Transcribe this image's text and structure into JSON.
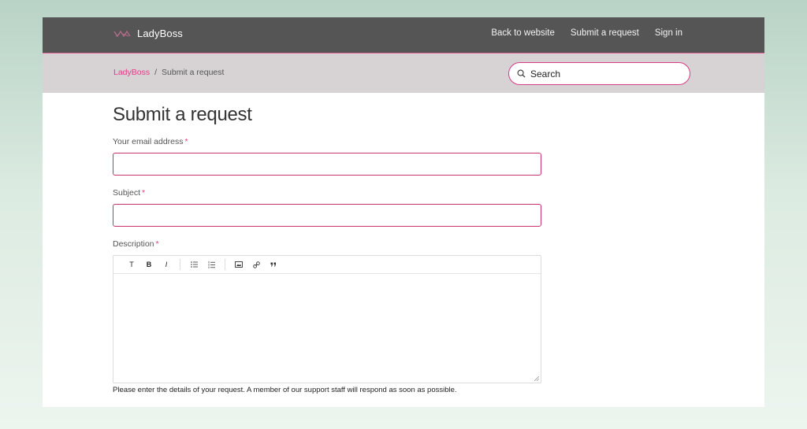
{
  "header": {
    "brand": "LadyBoss",
    "nav": [
      "Back to website",
      "Submit a request",
      "Sign in"
    ]
  },
  "breadcrumb": {
    "home": "LadyBoss",
    "separator": "/",
    "current": "Submit a request"
  },
  "search": {
    "placeholder": "Search"
  },
  "form": {
    "title": "Submit a request",
    "email_label": "Your email address",
    "subject_label": "Subject",
    "description_label": "Description",
    "required_mark": "*",
    "email_value": "",
    "subject_value": "",
    "toolbar": [
      "T",
      "B",
      "I"
    ],
    "hint": "Please enter the details of your request. A member of our support staff will respond as soon as possible."
  },
  "colors": {
    "accent": "#e8388a",
    "topbar": "#555555",
    "subbar": "#d7d3d5"
  }
}
